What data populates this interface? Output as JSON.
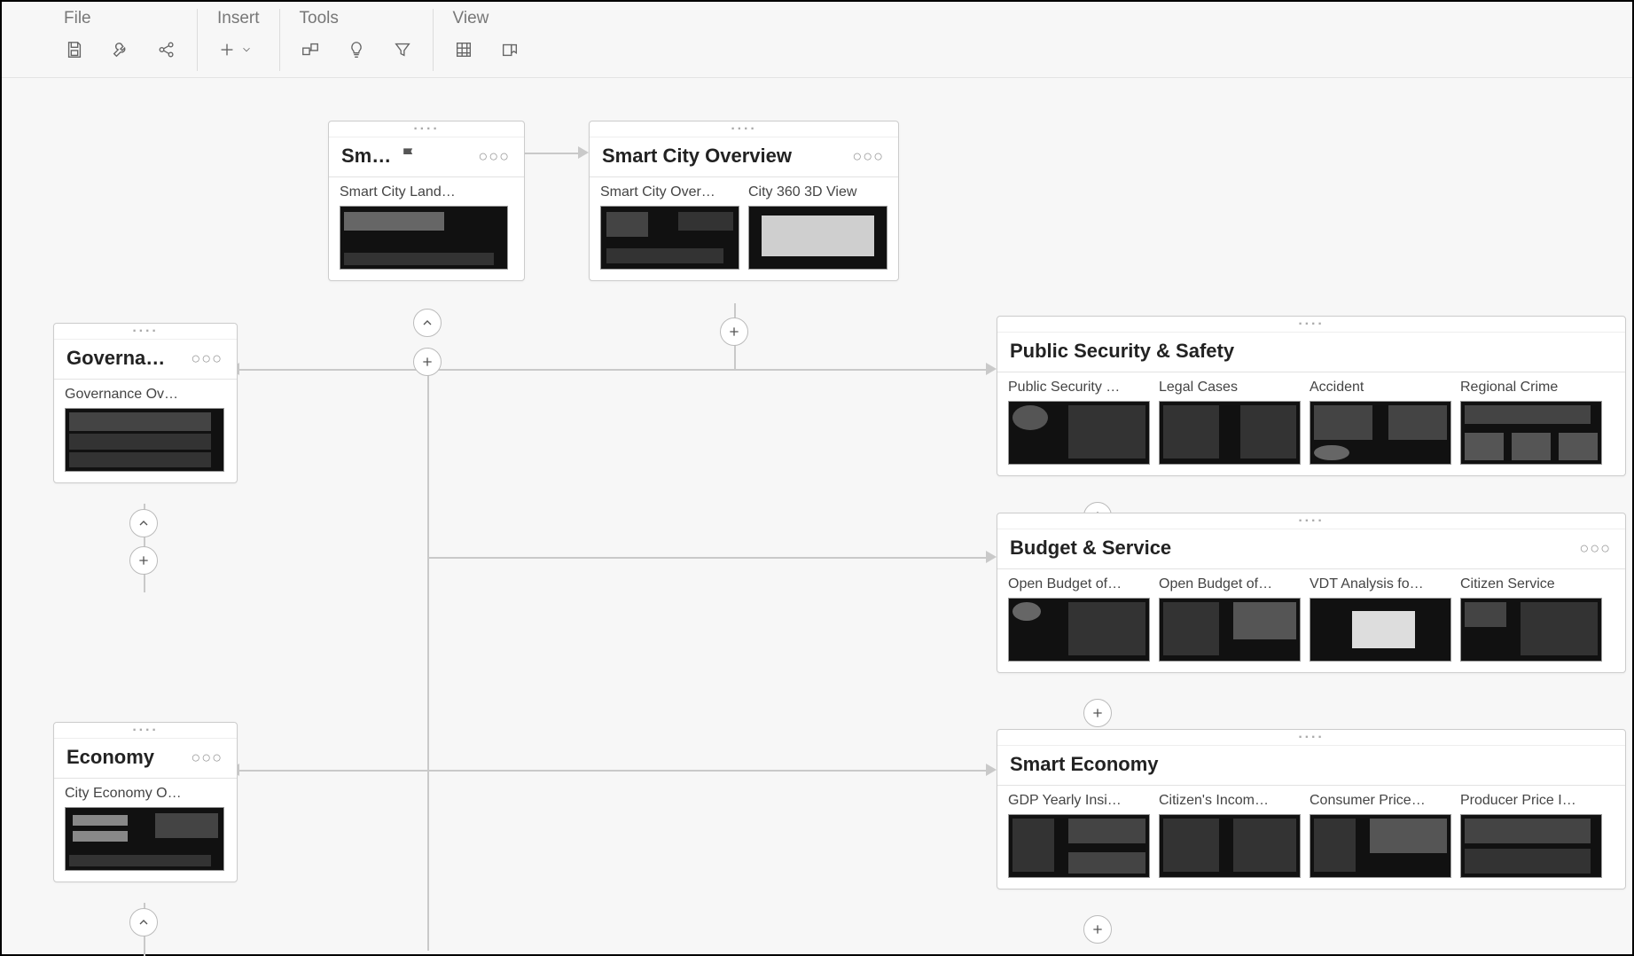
{
  "toolbar": {
    "groups": [
      {
        "label": "File"
      },
      {
        "label": "Insert"
      },
      {
        "label": "Tools"
      },
      {
        "label": "View"
      }
    ]
  },
  "nodes": {
    "smartCity": {
      "title": "Sm…",
      "pages": [
        {
          "label": "Smart City Land…"
        }
      ]
    },
    "overview": {
      "title": "Smart City Overview",
      "pages": [
        {
          "label": "Smart City Over…"
        },
        {
          "label": "City 360 3D View"
        }
      ]
    },
    "governance": {
      "title": "Governa…",
      "pages": [
        {
          "label": "Governance Ov…"
        }
      ]
    },
    "publicSecurity": {
      "title": "Public Security & Safety",
      "pages": [
        {
          "label": "Public Security …"
        },
        {
          "label": "Legal Cases"
        },
        {
          "label": "Accident"
        },
        {
          "label": "Regional Crime"
        }
      ]
    },
    "budget": {
      "title": "Budget & Service",
      "pages": [
        {
          "label": "Open Budget of…"
        },
        {
          "label": "Open Budget of…"
        },
        {
          "label": "VDT Analysis fo…"
        },
        {
          "label": "Citizen Service"
        }
      ]
    },
    "economy": {
      "title": "Economy",
      "pages": [
        {
          "label": "City Economy O…"
        }
      ]
    },
    "smartEconomy": {
      "title": "Smart Economy",
      "pages": [
        {
          "label": "GDP Yearly Insi…"
        },
        {
          "label": "Citizen's Incom…"
        },
        {
          "label": "Consumer Price…"
        },
        {
          "label": "Producer Price I…"
        }
      ]
    }
  }
}
